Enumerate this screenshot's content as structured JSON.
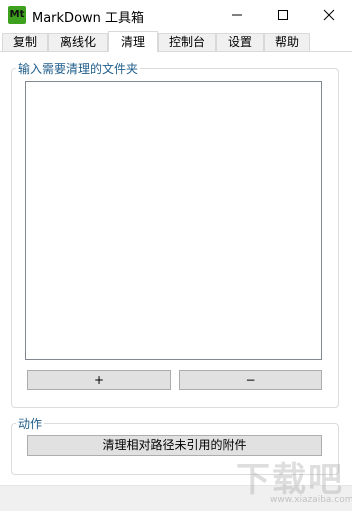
{
  "window": {
    "app_icon_text": "Mt",
    "title": "MarkDown 工具箱"
  },
  "tabs": [
    {
      "label": "复制"
    },
    {
      "label": "离线化"
    },
    {
      "label": "清理",
      "active": true
    },
    {
      "label": "控制台"
    },
    {
      "label": "设置"
    },
    {
      "label": "帮助"
    }
  ],
  "folder_group": {
    "legend": "输入需要清理的文件夹",
    "add_label": "+",
    "remove_label": "−"
  },
  "action_group": {
    "legend": "动作",
    "clean_button_label": "清理相对路径未引用的附件"
  },
  "watermark": {
    "main": "下载吧",
    "sub": "www.xiazaiba.com"
  },
  "colors": {
    "app_icon": "#3da01f",
    "legend": "#1f5d8a",
    "button_face": "#e1e1e1",
    "list_border": "#828790"
  }
}
